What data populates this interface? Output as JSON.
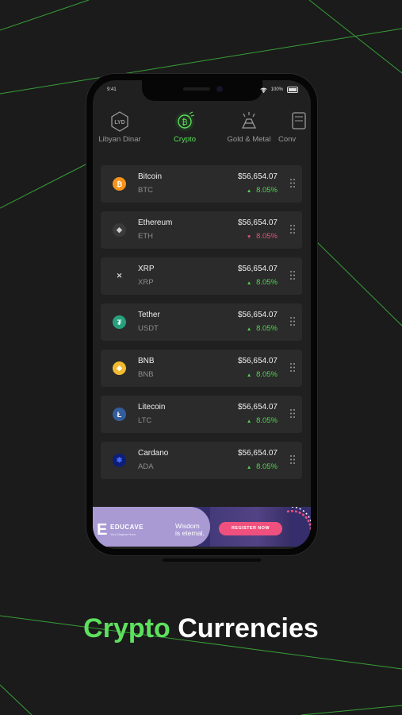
{
  "status_bar": {
    "time": "9:41",
    "battery": "100%"
  },
  "tabs": [
    {
      "label": "Libyan Dinar",
      "icon": "lyd-badge-icon",
      "badge": "LYD",
      "active": false
    },
    {
      "label": "Crypto",
      "icon": "bitcoin-badge-icon",
      "active": true
    },
    {
      "label": "Gold & Metal",
      "icon": "gold-bars-icon",
      "active": false
    },
    {
      "label": "Conv",
      "icon": "converter-icon",
      "active": false
    }
  ],
  "coins": [
    {
      "name": "Bitcoin",
      "symbol": "BTC",
      "price": "$56,654.07",
      "change": "8.05%",
      "direction": "up",
      "icon": "bitcoin-icon",
      "color": "#f7931a",
      "glyph": "₿"
    },
    {
      "name": "Ethereum",
      "symbol": "ETH",
      "price": "$56,654.07",
      "change": "8.05%",
      "direction": "down",
      "icon": "ethereum-icon",
      "color": "#3a3a3a",
      "glyph": "◆"
    },
    {
      "name": "XRP",
      "symbol": "XRP",
      "price": "$56,654.07",
      "change": "8.05%",
      "direction": "up",
      "icon": "xrp-icon",
      "color": "#2b2b2b",
      "glyph": "✕"
    },
    {
      "name": "Tether",
      "symbol": "USDT",
      "price": "$56,654.07",
      "change": "8.05%",
      "direction": "up",
      "icon": "tether-icon",
      "color": "#26a17b",
      "glyph": "₮"
    },
    {
      "name": "BNB",
      "symbol": "BNB",
      "price": "$56,654.07",
      "change": "8.05%",
      "direction": "up",
      "icon": "bnb-icon",
      "color": "#f3ba2f",
      "glyph": "◈"
    },
    {
      "name": "Litecoin",
      "symbol": "LTC",
      "price": "$56,654.07",
      "change": "8.05%",
      "direction": "up",
      "icon": "litecoin-icon",
      "color": "#345d9d",
      "glyph": "Ł"
    },
    {
      "name": "Cardano",
      "symbol": "ADA",
      "price": "$56,654.07",
      "change": "8.05%",
      "direction": "up",
      "icon": "cardano-icon",
      "color": "#0d1e7a",
      "glyph": "✱"
    }
  ],
  "ad": {
    "brand": "EDUCAVE",
    "tagline": "Your Degree Here",
    "message_line1": "Wisdom",
    "message_line2": "is eternal.",
    "cta": "REGISTER NOW"
  },
  "heading": {
    "accent": "Crypto",
    "rest": "Currencies"
  },
  "colors": {
    "accent": "#5ee05e",
    "up": "#4fd54f",
    "down": "#e4527a",
    "card": "#2b2b2b",
    "background": "#1b1b1b"
  }
}
